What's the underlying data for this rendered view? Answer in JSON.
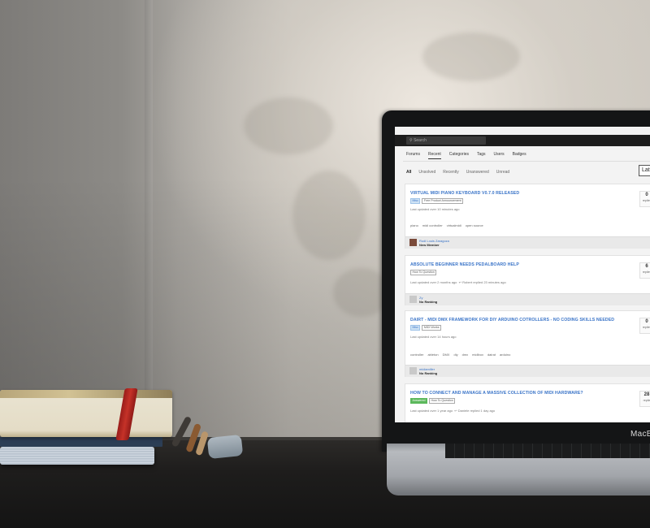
{
  "scene": {
    "description_colors": {
      "wall": "#d2cec6",
      "desk": "#1e1d1c",
      "book_band": "#c53228"
    },
    "laptop_brand": "MacB"
  },
  "forum": {
    "search_placeholder": "Search",
    "nav": [
      "Forums",
      "Recent",
      "Categories",
      "Tags",
      "Users",
      "Badges"
    ],
    "nav_active": "Recent",
    "filters": [
      "All",
      "Unsolved",
      "Recently",
      "Unanswered",
      "Unread"
    ],
    "filter_active": "All",
    "latest_button": "Lat",
    "topics": [
      {
        "title": "VIRTUAL MIDI PIANO KEYBOARD V0.7.0 RELEASED",
        "tags": [
          "Misc",
          "Free Product Announcement"
        ],
        "meta": "Last updated over 10 minutes ago",
        "labels": [
          "piano",
          "midi controller",
          "virtualmidi",
          "open source"
        ],
        "author": "Rudi Louis Zaragoza",
        "rank": "New Member",
        "replies": "0",
        "replies_label": "replies"
      },
      {
        "title": "ABSOLUTE BEGINNER NEEDS PEDALBOARD HELP",
        "tags": [
          "How To Question"
        ],
        "meta": "Last updated over 2 months ago",
        "meta2": "Robert replied 23 minutes ago",
        "labels": [],
        "author": "Zy",
        "rank": "No Ranking",
        "replies": "6",
        "replies_label": "replies"
      },
      {
        "title": "DAIRT - MIDI DMX FRAMEWORK FOR DIY ARDUINO COTROLLERS - NO CODING SKILLS NEEDED",
        "tags": [
          "Misc",
          "MIDI Works"
        ],
        "meta": "Last updated over 14 hours ago",
        "labels": [
          "controller",
          "ableton",
          "DMX",
          "diy",
          "dmx",
          "midibox",
          "dairat",
          "arduino"
        ],
        "author": "midiamiller",
        "rank": "No Ranking",
        "replies": "0",
        "replies_label": "replies"
      },
      {
        "title": "HOW TO CONNECT AND MANAGE A MASSIVE COLLECTION OF MIDI HARDWARE?",
        "tags": [
          "Answered",
          "How To Question"
        ],
        "meta": "Last updated over 1 year ago",
        "meta2": "Daniele replied 1 day ago",
        "labels": [],
        "author": "",
        "rank": "",
        "replies": "28",
        "replies_label": "replie"
      }
    ]
  }
}
